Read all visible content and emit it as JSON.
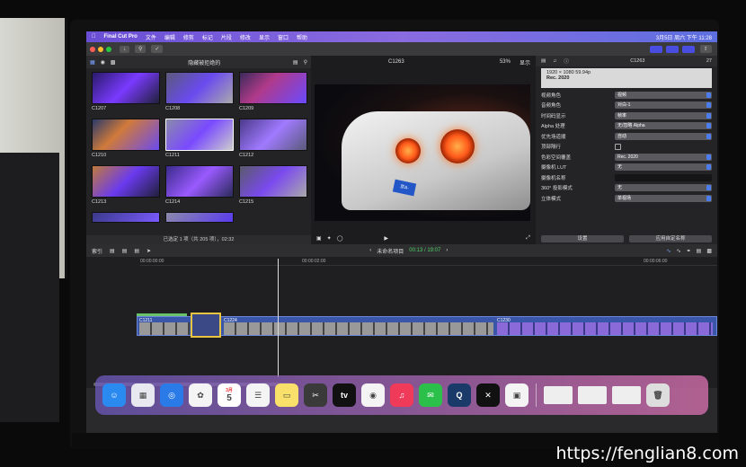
{
  "menubar": {
    "app": "Final Cut Pro",
    "items": [
      "文件",
      "编辑",
      "修剪",
      "标记",
      "片段",
      "修改",
      "显示",
      "窗口",
      "帮助"
    ],
    "clock": "3月5日 周六 下午 11:28"
  },
  "browser": {
    "filter_label": "隐藏被拒绝的",
    "clips": [
      "C1207",
      "C1208",
      "C1209",
      "C1210",
      "C1211",
      "C1212",
      "C1213",
      "C1214",
      "C1215",
      "",
      ""
    ],
    "selection_text": "已选定 1 项（共 205 项），02:32"
  },
  "viewer": {
    "clip_name": "C1263",
    "zoom": "53%",
    "view_menu": "显示",
    "plate": "京A·"
  },
  "inspector": {
    "clip_name": "C1263",
    "duration": "27",
    "format_line": "1920 × 1080 59.94p",
    "colorspace_line": "Rec. 2020",
    "rows": [
      {
        "label": "视频角色",
        "value": "视频"
      },
      {
        "label": "音频角色",
        "value": "对白-1"
      },
      {
        "label": "时间码显示",
        "value": "帧率"
      },
      {
        "label": "Alpha 处理",
        "value": "无/忽略 Alpha"
      },
      {
        "label": "优先场道顺",
        "value": "自动"
      },
      {
        "label": "顶部隔行",
        "value": ""
      },
      {
        "label": "色彩空间覆盖",
        "value": "Rec. 2020"
      },
      {
        "label": "摄像机 LUT",
        "value": "无"
      },
      {
        "label": "摄像机名称",
        "value": ""
      },
      {
        "label": "360° 投影模式",
        "value": "无"
      },
      {
        "label": "立体模式",
        "value": "单视场"
      }
    ],
    "btn_settings": "设置",
    "btn_apply": "应用自定名称"
  },
  "timeline_bar": {
    "index_label": "索引",
    "project_name": "未命名项目",
    "timecode": "00:13 / 19:07"
  },
  "ruler": [
    "00:00:00:00",
    "00:00:02:00",
    "00:00:06:00"
  ],
  "track_labels": [
    "C1211",
    "C1224",
    "C1230"
  ],
  "dock": [
    "Finder",
    "启动台",
    "Safari",
    "照片",
    "日历",
    "提醒事项",
    "备忘录",
    "Final Cut Pro",
    "Apple TV",
    "Game Center",
    "音乐",
    "微信",
    "QuickTime",
    "剪映",
    "预览",
    "",
    "",
    "",
    "废纸篓"
  ],
  "calendar_day": "5",
  "calendar_month": "3月",
  "watermark": "https://fenglian8.com",
  "colors": {
    "accent": "#4b7cf0",
    "menubar": "#6a4fd6",
    "timecode": "#4fd26a",
    "clip_blue": "#3a56a8"
  }
}
